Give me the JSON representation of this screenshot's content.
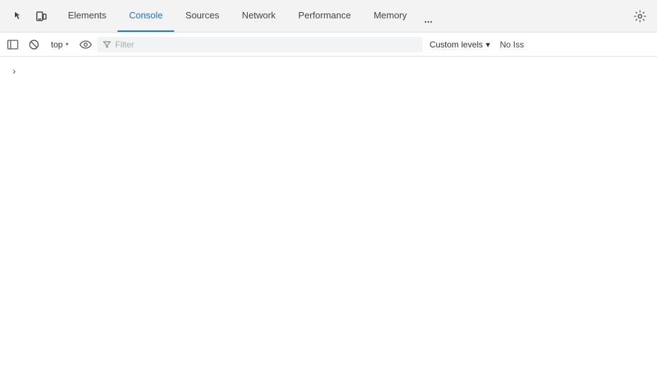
{
  "tabs": [
    {
      "id": "elements",
      "label": "Elements",
      "active": false
    },
    {
      "id": "console",
      "label": "Console",
      "active": true
    },
    {
      "id": "sources",
      "label": "Sources",
      "active": false
    },
    {
      "id": "network",
      "label": "Network",
      "active": false
    },
    {
      "id": "performance",
      "label": "Performance",
      "active": false
    },
    {
      "id": "memory",
      "label": "Memory",
      "active": false
    }
  ],
  "toolbar": {
    "context": {
      "label": "top",
      "chevron": "▾"
    },
    "filter": {
      "placeholder": "Filter"
    },
    "custom_levels": {
      "label": "Custom levels",
      "chevron": "▾"
    },
    "no_issues": "No Iss"
  },
  "console": {
    "expand_arrow": "›"
  },
  "colors": {
    "active_tab": "#1a73e8",
    "border": "#e0e0e0",
    "bg_tabbar": "#f3f3f3"
  }
}
